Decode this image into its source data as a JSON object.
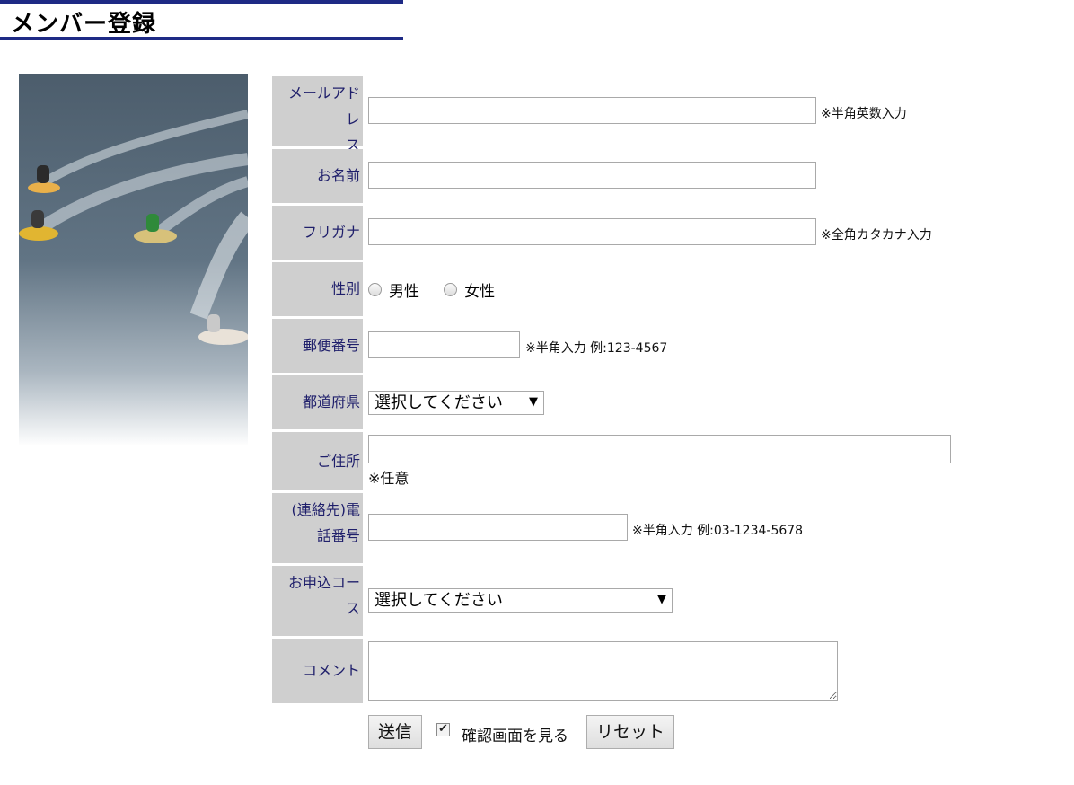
{
  "page": {
    "title": "メンバー登録"
  },
  "form": {
    "email": {
      "label_line1": "メールアドレ",
      "label_line2": "ス",
      "value": "",
      "note": "※半角英数入力"
    },
    "name": {
      "label": "お名前",
      "value": ""
    },
    "furigana": {
      "label": "フリガナ",
      "value": "",
      "note": "※全角カタカナ入力"
    },
    "gender": {
      "label": "性別",
      "options": [
        "男性",
        "女性"
      ]
    },
    "postal": {
      "label": "郵便番号",
      "value": "",
      "note": "※半角入力 例:123-4567"
    },
    "prefecture": {
      "label": "都道府県",
      "selected": "選択してください"
    },
    "address": {
      "label": "ご住所",
      "value": "",
      "note": "※任意"
    },
    "phone": {
      "label_line1": "(連絡先)電",
      "label_line2": "話番号",
      "value": "",
      "note": "※半角入力 例:03-1234-5678"
    },
    "course": {
      "label_line1": "お申込コー",
      "label_line2": "ス",
      "selected": "選択してください"
    },
    "comment": {
      "label": "コメント",
      "value": ""
    },
    "actions": {
      "submit_label": "送信",
      "confirm_label": "確認画面を見る",
      "confirm_checked": true,
      "reset_label": "リセット"
    }
  },
  "icons": {
    "select_arrow": "▼",
    "check_mark": "✔"
  }
}
